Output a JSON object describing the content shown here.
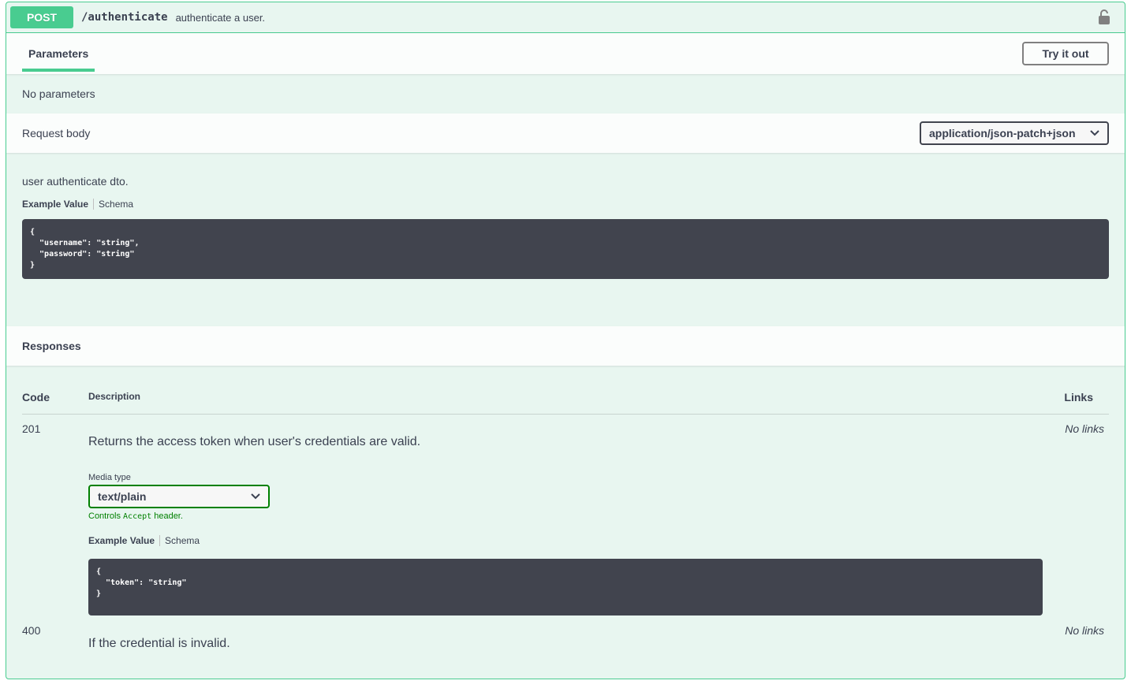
{
  "summary": {
    "method": "POST",
    "path": "/authenticate",
    "description": "authenticate a user."
  },
  "parameters": {
    "tab_label": "Parameters",
    "try_button": "Try it out",
    "empty_text": "No parameters"
  },
  "request_body": {
    "title": "Request body",
    "content_type": "application/json-patch+json",
    "description": "user authenticate dto.",
    "tab_example": "Example Value",
    "tab_schema": "Schema",
    "example": "{\n  \"username\": \"string\",\n  \"password\": \"string\"\n}"
  },
  "responses": {
    "title": "Responses",
    "col_code": "Code",
    "col_description": "Description",
    "col_links": "Links",
    "rows": [
      {
        "code": "201",
        "description": "Returns the access token when user's credentials are valid.",
        "links": "No links",
        "media_type_label": "Media type",
        "media_type": "text/plain",
        "note_prefix": "Controls",
        "note_code": "Accept",
        "note_suffix": "header.",
        "tab_example": "Example Value",
        "tab_schema": "Schema",
        "example": "{\n  \"token\": \"string\"\n}"
      },
      {
        "code": "400",
        "description": "If the credential is invalid.",
        "links": "No links"
      }
    ]
  },
  "colors": {
    "accent": "#49cc90",
    "background": "#e8f6f0",
    "code_bg": "#41444e",
    "media_ok": "#008000"
  }
}
